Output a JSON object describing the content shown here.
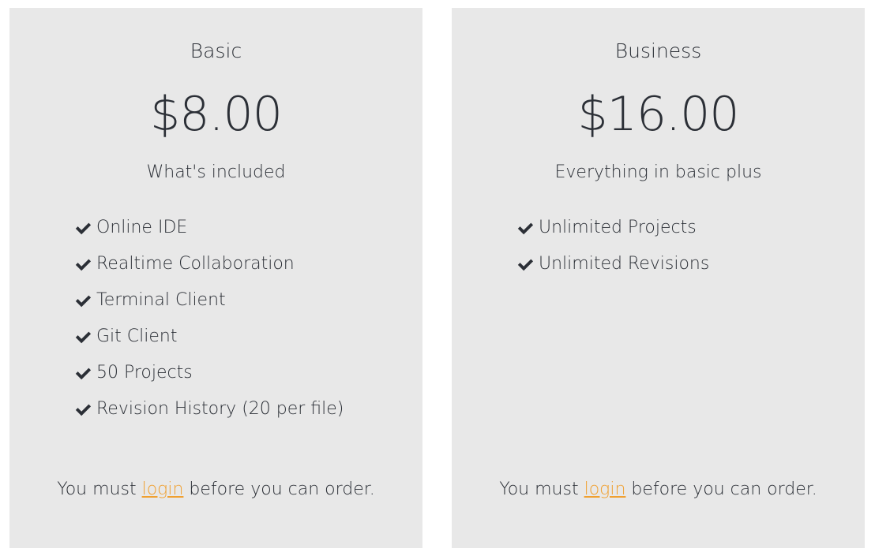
{
  "plans": [
    {
      "name": "Basic",
      "price": "$8.00",
      "subtitle": "What's included",
      "features": [
        "Online IDE",
        "Realtime Collaboration",
        "Terminal Client",
        "Git Client",
        "50 Projects",
        "Revision History (20 per file)"
      ],
      "footer_prefix": "You must ",
      "footer_link": "login",
      "footer_suffix": " before you can order."
    },
    {
      "name": "Business",
      "price": "$16.00",
      "subtitle": "Everything in basic plus",
      "features": [
        "Unlimited Projects",
        "Unlimited Revisions"
      ],
      "footer_prefix": "You must ",
      "footer_link": "login",
      "footer_suffix": " before you can order."
    }
  ],
  "icons": {
    "feature_bullet": "check-icon"
  },
  "colors": {
    "card_bg": "#e8e8e8",
    "text": "#2b2f36",
    "link": "#f0a030"
  }
}
